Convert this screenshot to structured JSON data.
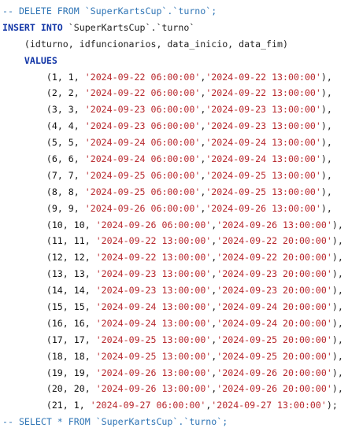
{
  "editor": {
    "lines": [
      {
        "kind": "comment",
        "text": "-- DELETE FROM `SuperKartsCup`.`turno`;"
      },
      {
        "kind": "insert",
        "keyword": "INSERT INTO",
        "table": " `SuperKartsCup`.`turno`"
      },
      {
        "kind": "columns",
        "text": "    (idturno, idfuncionarios, data_inicio, data_fim)"
      },
      {
        "kind": "values",
        "keyword": "    VALUES"
      },
      {
        "kind": "row",
        "id": "1",
        "func": "1",
        "start": "'2024-09-22 06:00:00'",
        "end": "'2024-09-22 13:00:00'",
        "term": "),"
      },
      {
        "kind": "row",
        "id": "2",
        "func": "2",
        "start": "'2024-09-22 06:00:00'",
        "end": "'2024-09-22 13:00:00'",
        "term": "),"
      },
      {
        "kind": "row",
        "id": "3",
        "func": "3",
        "start": "'2024-09-23 06:00:00'",
        "end": "'2024-09-23 13:00:00'",
        "term": "),"
      },
      {
        "kind": "row",
        "id": "4",
        "func": "4",
        "start": "'2024-09-23 06:00:00'",
        "end": "'2024-09-23 13:00:00'",
        "term": "),"
      },
      {
        "kind": "row",
        "id": "5",
        "func": "5",
        "start": "'2024-09-24 06:00:00'",
        "end": "'2024-09-24 13:00:00'",
        "term": "),"
      },
      {
        "kind": "row",
        "id": "6",
        "func": "6",
        "start": "'2024-09-24 06:00:00'",
        "end": "'2024-09-24 13:00:00'",
        "term": "),"
      },
      {
        "kind": "row",
        "id": "7",
        "func": "7",
        "start": "'2024-09-25 06:00:00'",
        "end": "'2024-09-25 13:00:00'",
        "term": "),"
      },
      {
        "kind": "row",
        "id": "8",
        "func": "8",
        "start": "'2024-09-25 06:00:00'",
        "end": "'2024-09-25 13:00:00'",
        "term": "),"
      },
      {
        "kind": "row",
        "id": "9",
        "func": "9",
        "start": "'2024-09-26 06:00:00'",
        "end": "'2024-09-26 13:00:00'",
        "term": "),"
      },
      {
        "kind": "row",
        "id": "10",
        "func": "10",
        "start": "'2024-09-26 06:00:00'",
        "end": "'2024-09-26 13:00:00'",
        "term": "),"
      },
      {
        "kind": "row",
        "id": "11",
        "func": "11",
        "start": "'2024-09-22 13:00:00'",
        "end": "'2024-09-22 20:00:00'",
        "term": "),"
      },
      {
        "kind": "row",
        "id": "12",
        "func": "12",
        "start": "'2024-09-22 13:00:00'",
        "end": "'2024-09-22 20:00:00'",
        "term": "),"
      },
      {
        "kind": "row",
        "id": "13",
        "func": "13",
        "start": "'2024-09-23 13:00:00'",
        "end": "'2024-09-23 20:00:00'",
        "term": "),"
      },
      {
        "kind": "row",
        "id": "14",
        "func": "14",
        "start": "'2024-09-23 13:00:00'",
        "end": "'2024-09-23 20:00:00'",
        "term": "),"
      },
      {
        "kind": "row",
        "id": "15",
        "func": "15",
        "start": "'2024-09-24 13:00:00'",
        "end": "'2024-09-24 20:00:00'",
        "term": "),"
      },
      {
        "kind": "row",
        "id": "16",
        "func": "16",
        "start": "'2024-09-24 13:00:00'",
        "end": "'2024-09-24 20:00:00'",
        "term": "),"
      },
      {
        "kind": "row",
        "id": "17",
        "func": "17",
        "start": "'2024-09-25 13:00:00'",
        "end": "'2024-09-25 20:00:00'",
        "term": "),"
      },
      {
        "kind": "row",
        "id": "18",
        "func": "18",
        "start": "'2024-09-25 13:00:00'",
        "end": "'2024-09-25 20:00:00'",
        "term": "),"
      },
      {
        "kind": "row",
        "id": "19",
        "func": "19",
        "start": "'2024-09-26 13:00:00'",
        "end": "'2024-09-26 20:00:00'",
        "term": "),"
      },
      {
        "kind": "row",
        "id": "20",
        "func": "20",
        "start": "'2024-09-26 13:00:00'",
        "end": "'2024-09-26 20:00:00'",
        "term": "),"
      },
      {
        "kind": "row",
        "id": "21",
        "func": "1",
        "start": "'2024-09-27 06:00:00'",
        "end": "'2024-09-27 13:00:00'",
        "term": ");"
      },
      {
        "kind": "comment",
        "text": "-- SELECT * FROM `SuperKartsCup`.`turno`;"
      }
    ]
  }
}
